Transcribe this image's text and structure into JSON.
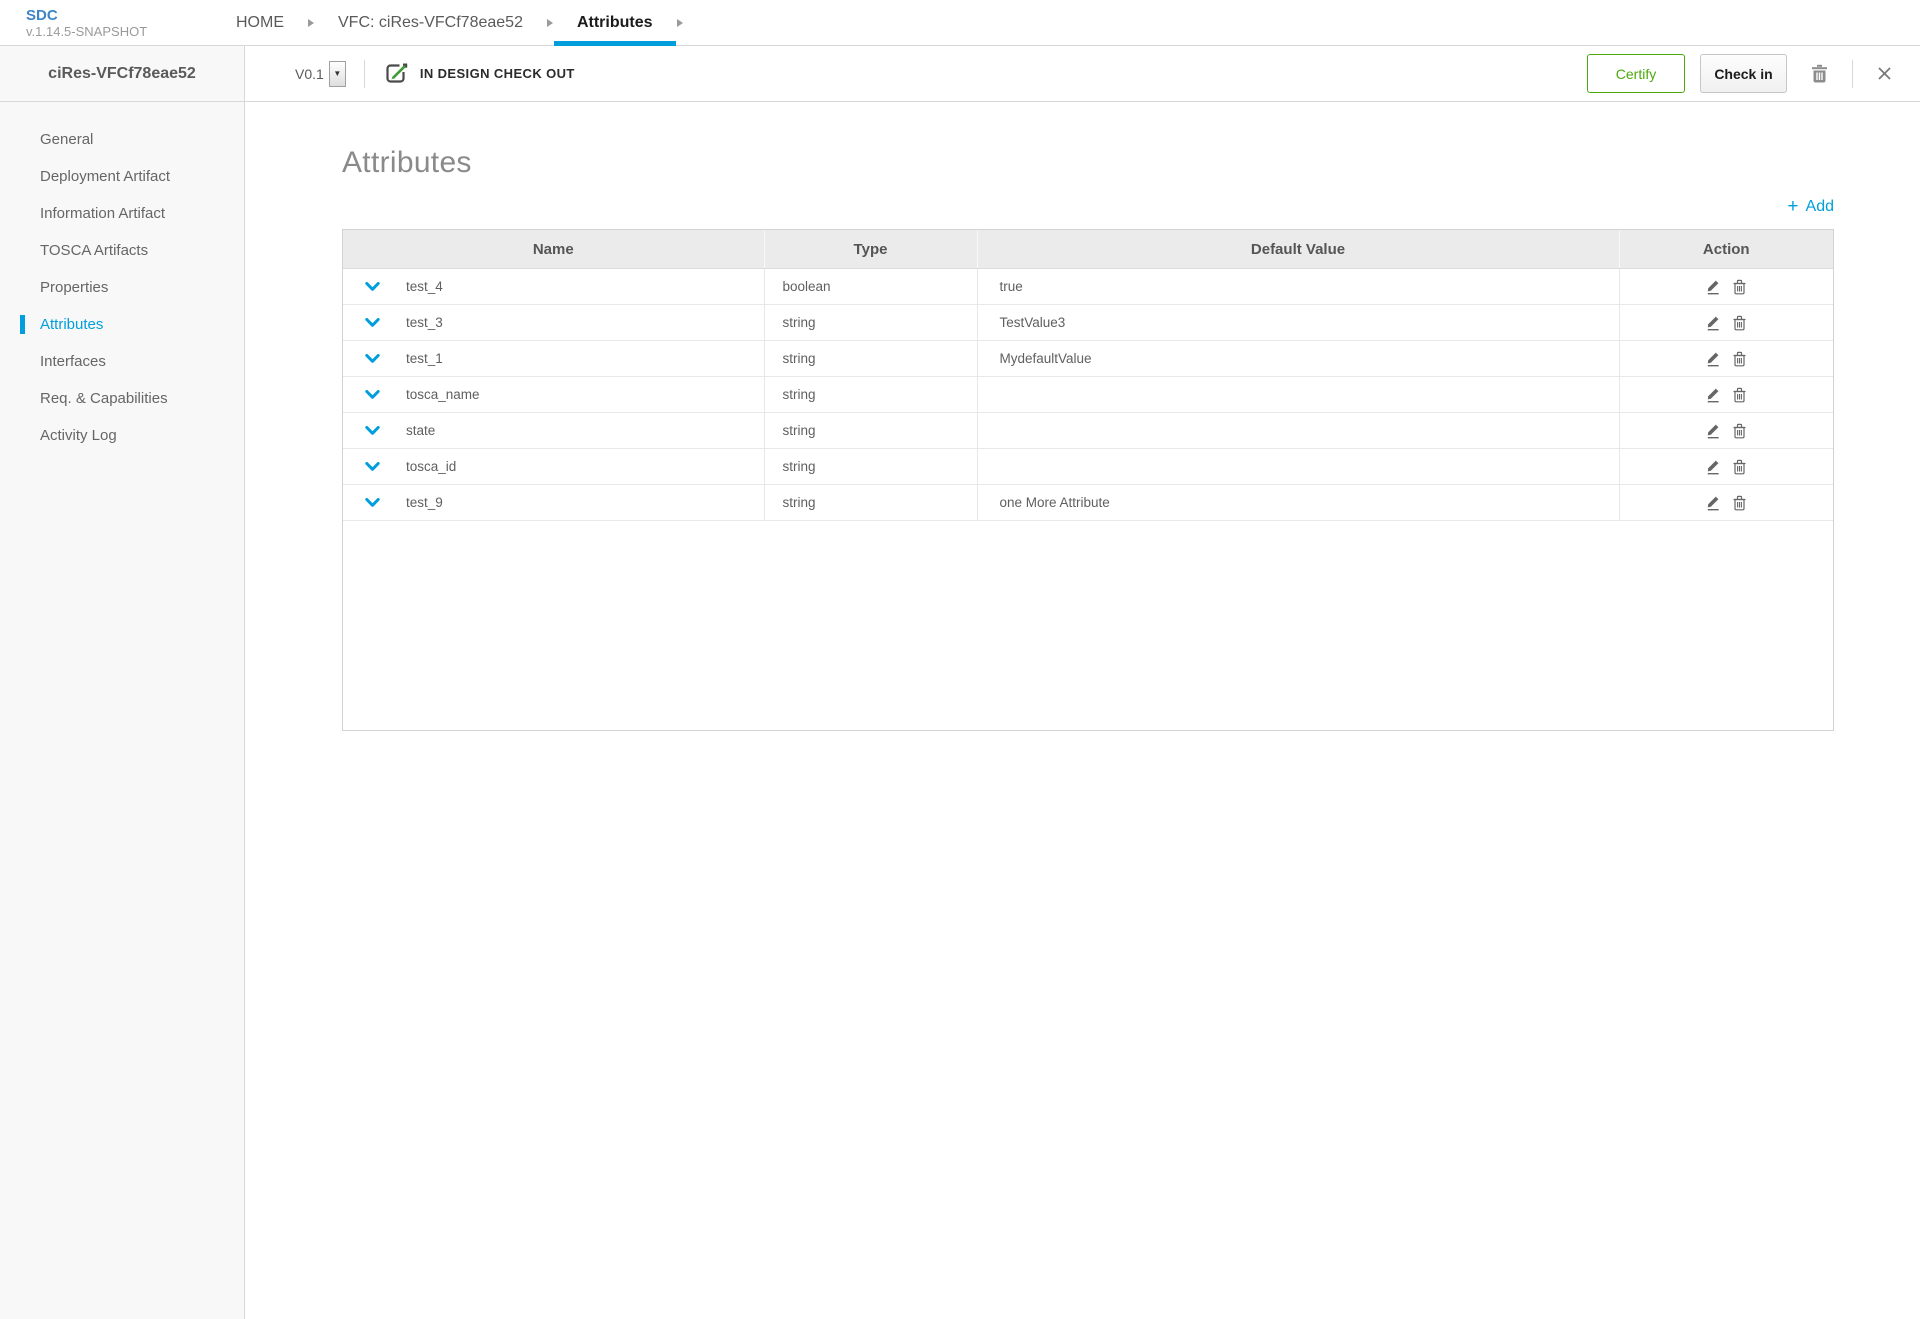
{
  "app": {
    "name": "SDC",
    "version": "v.1.14.5-SNAPSHOT"
  },
  "breadcrumb": {
    "items": [
      {
        "label": "HOME",
        "active": false
      },
      {
        "label": "VFC: ciRes-VFCf78eae52",
        "active": false
      },
      {
        "label": "Attributes",
        "active": true
      }
    ]
  },
  "panel": {
    "title": "ciRes-VFCf78eae52"
  },
  "toolbar": {
    "version": "V0.1",
    "status": "IN DESIGN CHECK OUT",
    "certify_label": "Certify",
    "checkin_label": "Check in"
  },
  "sidebar": {
    "items": [
      {
        "label": "General",
        "active": false
      },
      {
        "label": "Deployment Artifact",
        "active": false
      },
      {
        "label": "Information Artifact",
        "active": false
      },
      {
        "label": "TOSCA Artifacts",
        "active": false
      },
      {
        "label": "Properties",
        "active": false
      },
      {
        "label": "Attributes",
        "active": true
      },
      {
        "label": "Interfaces",
        "active": false
      },
      {
        "label": "Req. & Capabilities",
        "active": false
      },
      {
        "label": "Activity Log",
        "active": false
      }
    ]
  },
  "content": {
    "title": "Attributes",
    "add_plus": "+",
    "add_label": "Add"
  },
  "table": {
    "headers": [
      "Name",
      "Type",
      "Default Value",
      "Action"
    ],
    "rows": [
      {
        "name": "test_4",
        "type": "boolean",
        "default_value": "true"
      },
      {
        "name": "test_3",
        "type": "string",
        "default_value": "TestValue3"
      },
      {
        "name": "test_1",
        "type": "string",
        "default_value": "MydefaultValue"
      },
      {
        "name": "tosca_name",
        "type": "string",
        "default_value": ""
      },
      {
        "name": "state",
        "type": "string",
        "default_value": ""
      },
      {
        "name": "tosca_id",
        "type": "string",
        "default_value": ""
      },
      {
        "name": "test_9",
        "type": "string",
        "default_value": "one More Attribute"
      }
    ]
  },
  "icons": {
    "checkout": "pencil-square",
    "trash": "trash",
    "close": "x",
    "row_expand": "chevron-down",
    "edit": "pencil-underline",
    "delete": "trash-outline",
    "breadcrumb_arrow": "triangle-right",
    "version_caret": "▼"
  },
  "colors": {
    "accent": "#009fdb",
    "logo_blue": "#3d85c6",
    "certify_green": "#4ca90c",
    "icon_gray": "#666666"
  }
}
